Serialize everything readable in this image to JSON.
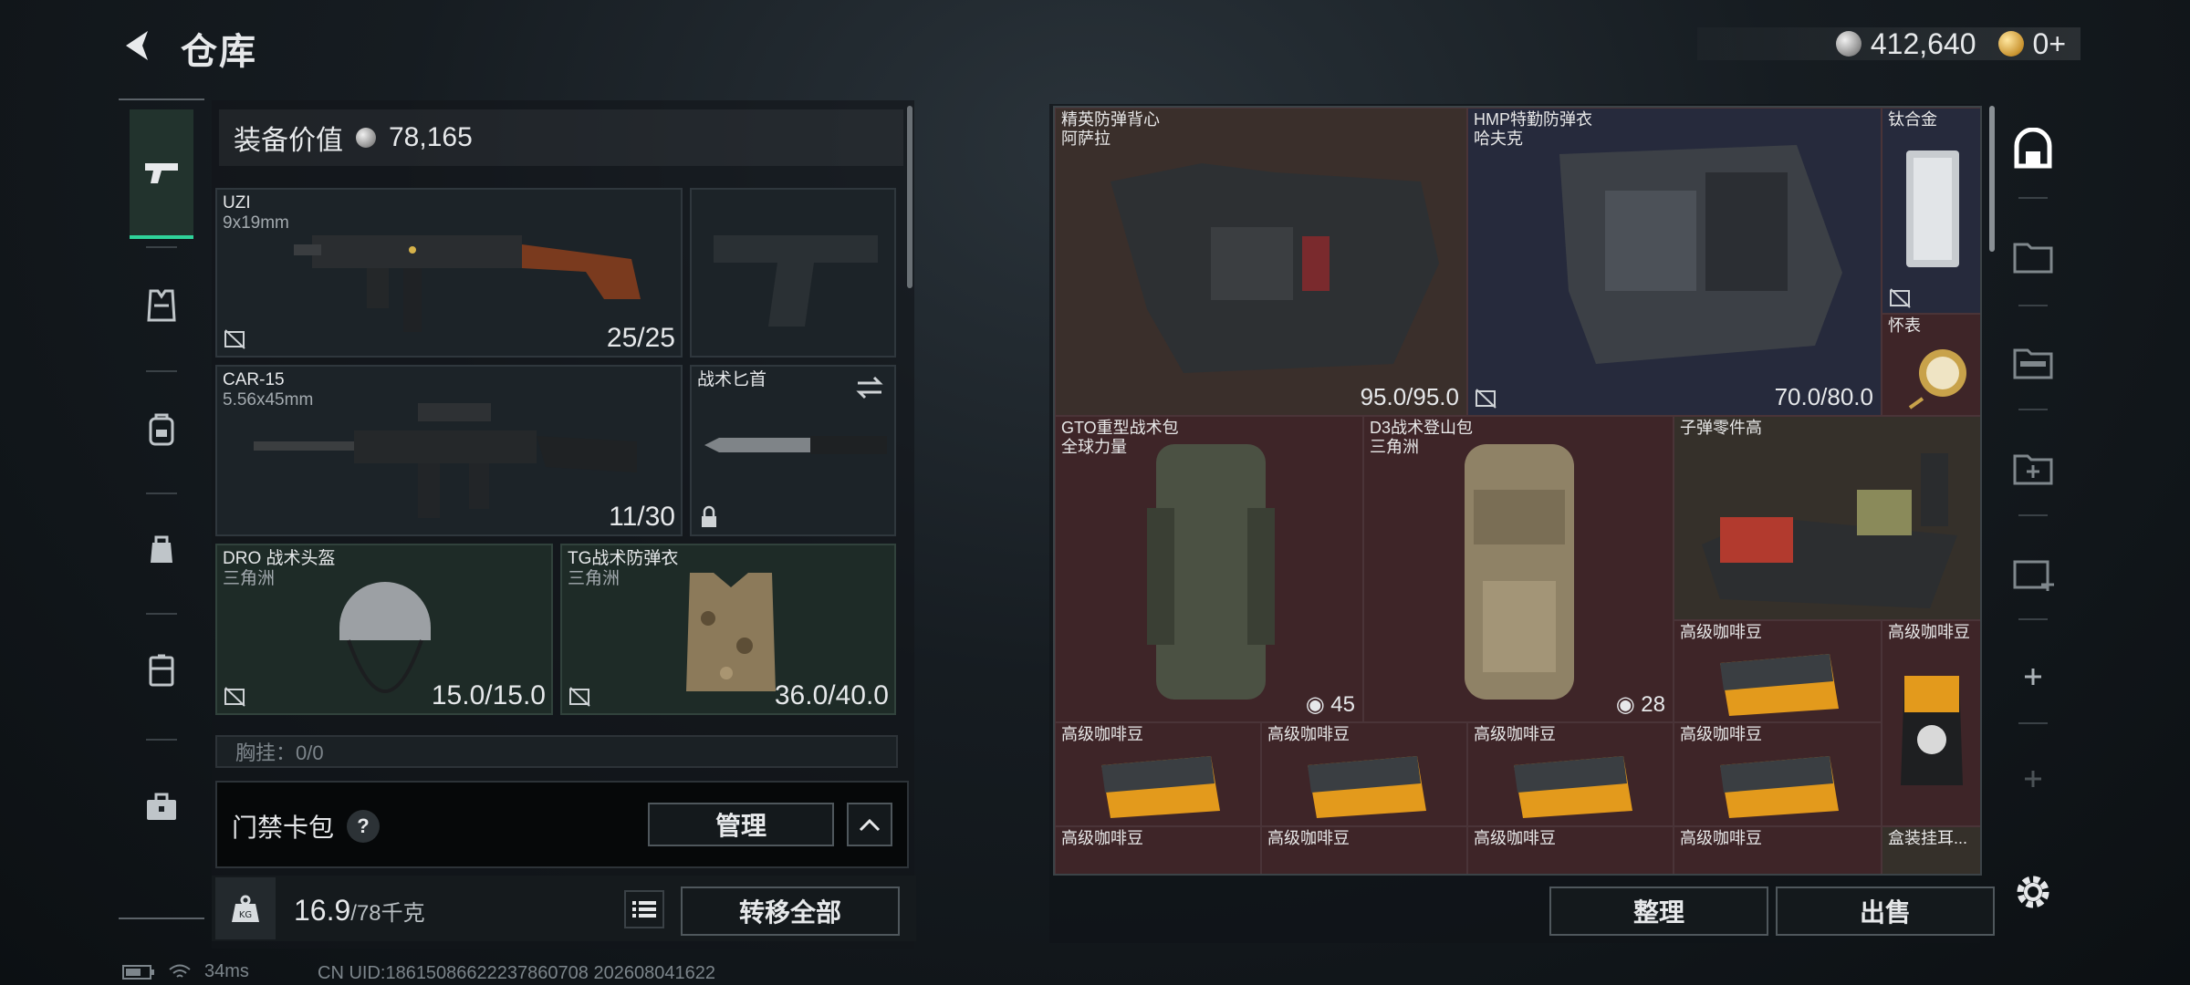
{
  "header": {
    "title": "仓库"
  },
  "currency": {
    "silver": "412,640",
    "gold": "0+"
  },
  "left_rail": {
    "items": [
      {
        "icon": "pistol-icon",
        "active": true
      },
      {
        "icon": "vest-icon"
      },
      {
        "icon": "backpack-icon"
      },
      {
        "icon": "bag-icon"
      },
      {
        "icon": "container-icon"
      },
      {
        "icon": "toolbox-icon"
      }
    ]
  },
  "equipment": {
    "value_label": "装备价值",
    "value": "78,165",
    "slots": [
      {
        "name": "UZI",
        "sub": "9x19mm",
        "count": "25/25"
      },
      {
        "name": "",
        "sub": "",
        "count": ""
      },
      {
        "name": "CAR-15",
        "sub": "5.56x45mm",
        "count": "11/30"
      },
      {
        "name": "战术匕首",
        "sub": "",
        "count": ""
      },
      {
        "name": "DRO 战术头盔",
        "sub": "三角洲",
        "count": "15.0/15.0"
      },
      {
        "name": "TG战术防弹衣",
        "sub": "三角洲",
        "count": "36.0/40.0"
      }
    ],
    "chest_label": "胸挂：0/0"
  },
  "keycard": {
    "label": "门禁卡包",
    "help": "?",
    "manage": "管理"
  },
  "weight": {
    "current": "16.9",
    "max": "/78千克",
    "icon_label": "KG"
  },
  "transfer_all": "转移全部",
  "grid": {
    "items": [
      {
        "name": "精英防弹背心",
        "sub": "阿萨拉",
        "value": "95.0/95.0"
      },
      {
        "name": "HMP特勤防弹衣",
        "sub": "哈夫克",
        "value": "70.0/80.0"
      },
      {
        "name": "钛合金",
        "sub": "",
        "value": ""
      },
      {
        "name": "怀表",
        "sub": "",
        "value": ""
      },
      {
        "name": "GTO重型战术包",
        "sub": "全球力量",
        "value": "45"
      },
      {
        "name": "D3战术登山包",
        "sub": "三角洲",
        "value": "28"
      },
      {
        "name": "子弹零件高",
        "sub": "",
        "value": ""
      },
      {
        "name": "高级咖啡豆",
        "sub": "",
        "value": ""
      },
      {
        "name": "高级咖啡豆",
        "sub": "",
        "value": ""
      },
      {
        "name": "高级咖啡豆",
        "sub": "",
        "value": ""
      },
      {
        "name": "高级咖啡豆",
        "sub": "",
        "value": ""
      },
      {
        "name": "高级咖啡豆",
        "sub": "",
        "value": ""
      },
      {
        "name": "高级咖啡豆",
        "sub": "",
        "value": ""
      },
      {
        "name": "高级咖啡豆",
        "sub": "",
        "value": ""
      },
      {
        "name": "高级咖啡豆",
        "sub": "",
        "value": ""
      },
      {
        "name": "高级咖啡豆",
        "sub": "",
        "value": ""
      },
      {
        "name": "高级咖啡豆",
        "sub": "",
        "value": ""
      },
      {
        "name": "盒装挂耳...",
        "sub": "",
        "value": ""
      }
    ],
    "sort": "整理",
    "sell": "出售"
  },
  "status": {
    "ping": "34ms",
    "uid": "CN UID:18615086622237860708  202608041622"
  },
  "colors": {
    "accent": "#2fd39a",
    "cell_maroon": "#3e2528",
    "cell_navy": "#262a3c",
    "cell_brown": "#3a2f2b"
  }
}
